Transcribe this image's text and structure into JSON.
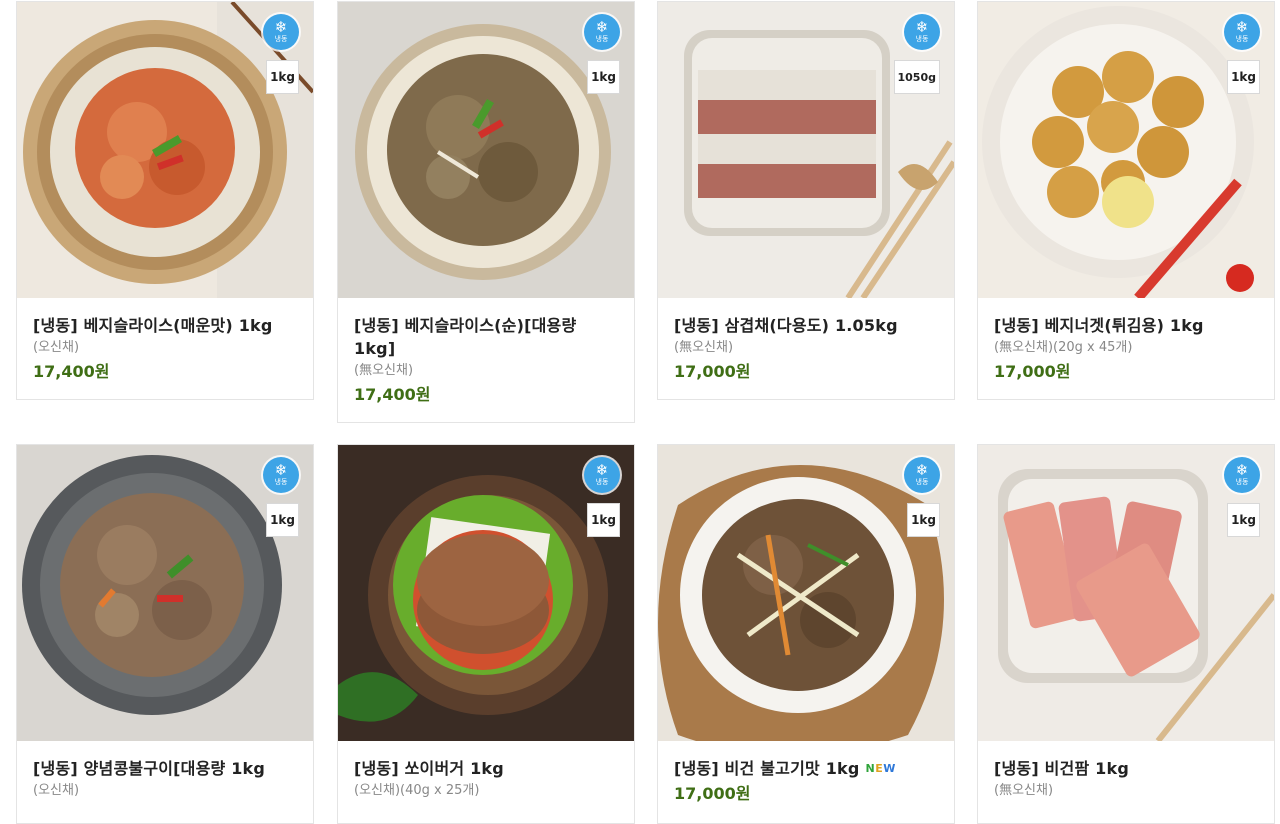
{
  "badges": {
    "frozen_label": "냉동",
    "snowflake": "❄",
    "new_label": [
      "N",
      "E",
      "W"
    ]
  },
  "colors": {
    "price": "#3f6e15",
    "frozen_badge": "#3da4e6",
    "border": "#e4e4e4"
  },
  "products": [
    {
      "title": "[냉동] 베지슬라이스(매운맛) 1kg",
      "sub": "(오신채)",
      "price": "17,400원",
      "weight": "1kg"
    },
    {
      "title": "[냉동] 베지슬라이스(순)[대용량 1kg]",
      "sub": "(無오신채)",
      "price": "17,400원",
      "weight": "1kg"
    },
    {
      "title": "[냉동] 삼겹채(다용도) 1.05kg",
      "sub": "(無오신채)",
      "price": "17,000원",
      "weight": "1050g"
    },
    {
      "title": "[냉동] 베지너겟(튀김용) 1kg",
      "sub": "(無오신채)(20g x 45개)",
      "price": "17,000원",
      "weight": "1kg"
    },
    {
      "title": "[냉동] 양념콩불구이[대용량 1kg",
      "sub": "(오신채)",
      "price": "",
      "weight": "1kg"
    },
    {
      "title": "[냉동] 쏘이버거 1kg",
      "sub": "(오신채)(40g x 25개)",
      "price": "",
      "weight": "1kg"
    },
    {
      "title": "[냉동] 비건 불고기맛 1kg",
      "sub": "",
      "price": "17,000원",
      "weight": "1kg",
      "is_new": true
    },
    {
      "title": "[냉동] 비건팜 1kg",
      "sub": "(無오신채)",
      "price": "",
      "weight": "1kg"
    }
  ]
}
